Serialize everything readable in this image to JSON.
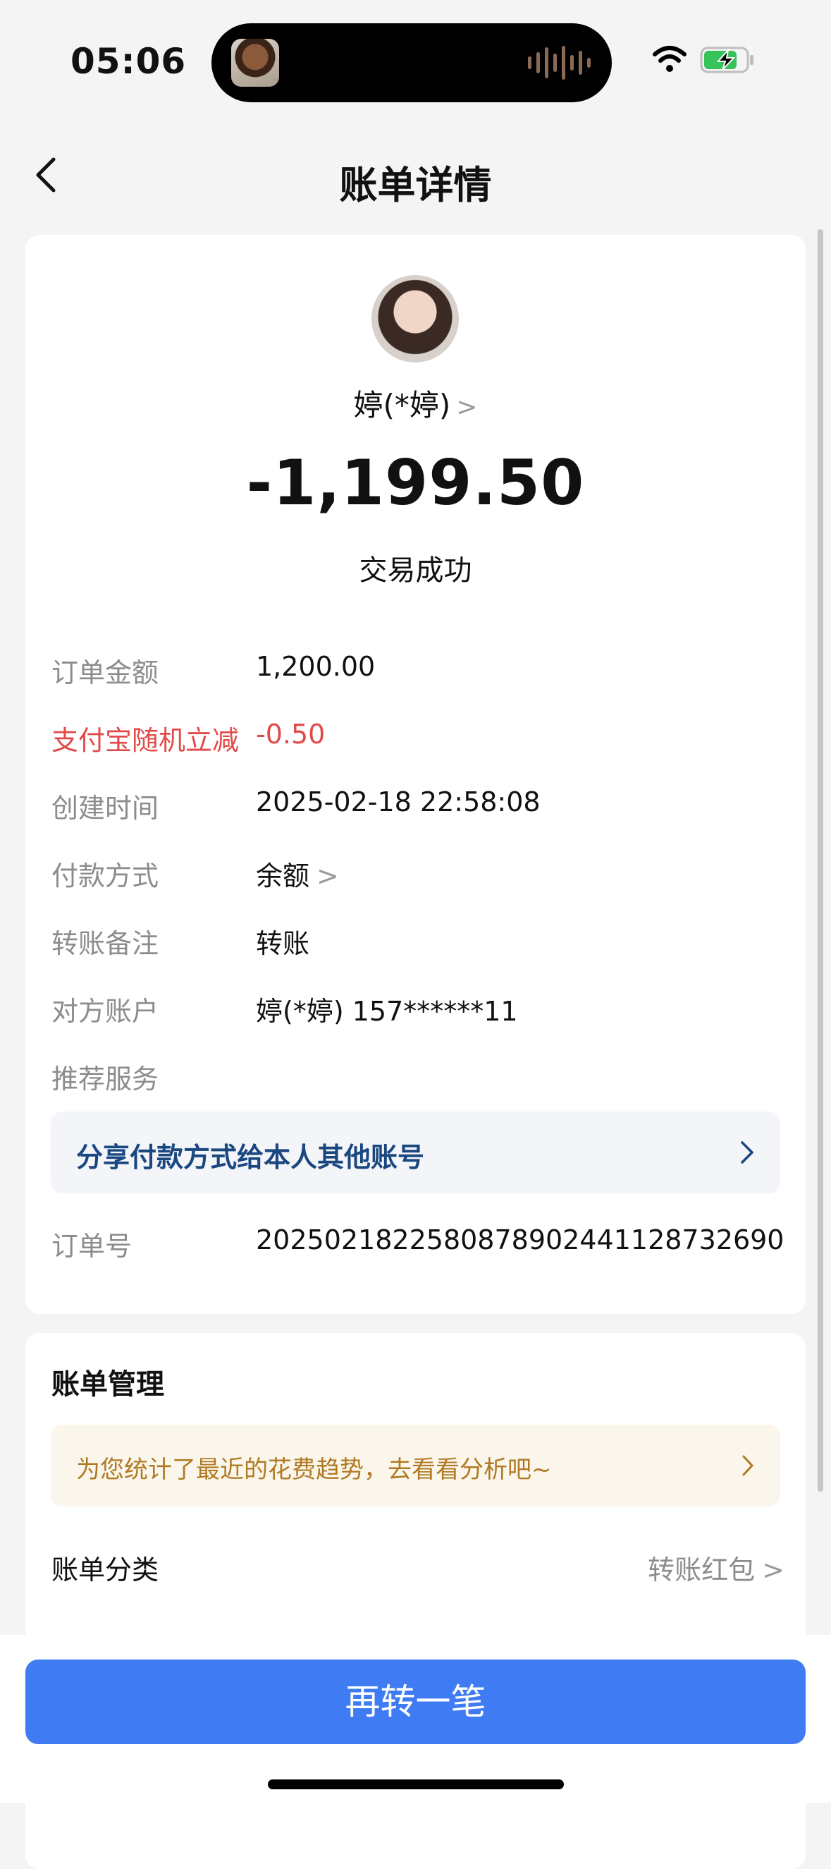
{
  "status_bar": {
    "time": "05:06"
  },
  "nav": {
    "title": "账单详情"
  },
  "summary": {
    "payee": "婷(*婷)",
    "amount": "-1,199.50",
    "status": "交易成功"
  },
  "details": [
    {
      "label": "订单金额",
      "value": "1,200.00"
    },
    {
      "label": "支付宝随机立减",
      "value": "-0.50"
    },
    {
      "label": "创建时间",
      "value": "2025-02-18 22:58:08"
    },
    {
      "label": "付款方式",
      "value": "余额"
    },
    {
      "label": "转账备注",
      "value": "转账"
    },
    {
      "label": "对方账户",
      "value": "婷(*婷) 157******11"
    },
    {
      "label": "推荐服务",
      "value": ""
    }
  ],
  "share_banner": {
    "text": "分享付款方式给本人其他账号"
  },
  "order": {
    "label": "订单号",
    "value": "2025021822580878902441128732690"
  },
  "manage": {
    "title": "账单管理",
    "trend_banner": "为您统计了最近的花费趋势，去看看分析吧~",
    "category_label": "账单分类",
    "category_value": "转账红包"
  },
  "cta": {
    "label": "再转一笔"
  },
  "colors": {
    "accent": "#3f7bf2",
    "negative": "#e24a4a",
    "link": "#1a4780",
    "warning_text": "#b07a22"
  }
}
